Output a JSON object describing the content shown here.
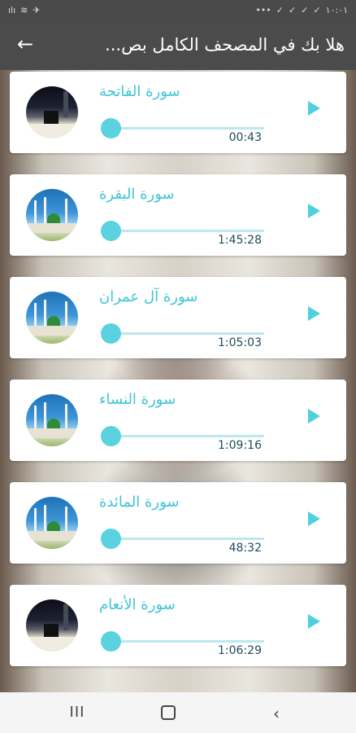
{
  "status_bar": {
    "time": "١٠:٠١",
    "right_icons": [
      "✓",
      "✓",
      "✓",
      "✓",
      "•••"
    ],
    "left_icons": [
      "ılı",
      "≋",
      "✈"
    ]
  },
  "app_bar": {
    "title": "هلا بك في المصحف الكامل بص...",
    "back_icon": "←"
  },
  "surahs": [
    {
      "name": "سورة الفاتحة",
      "time": "00:43",
      "image": "kaaba"
    },
    {
      "name": "سورة البقرة",
      "time": "1:45:28",
      "image": "mosque"
    },
    {
      "name": "سورة آل عمران",
      "time": "1:05:03",
      "image": "mosque"
    },
    {
      "name": "سورة النساء",
      "time": "1:09:16",
      "image": "mosque"
    },
    {
      "name": "سورة المائدة",
      "time": "48:32",
      "image": "mosque"
    },
    {
      "name": "سورة الأنعام",
      "time": "1:06:29",
      "image": "kaaba"
    }
  ],
  "colors": {
    "accent": "#3fc4d6",
    "app_bar": "#4b4b4b",
    "status_bar": "#4a4a4a"
  },
  "nav_bar": {
    "recent_icon": "III",
    "home_icon": "home-icon",
    "back_icon": "‹"
  }
}
